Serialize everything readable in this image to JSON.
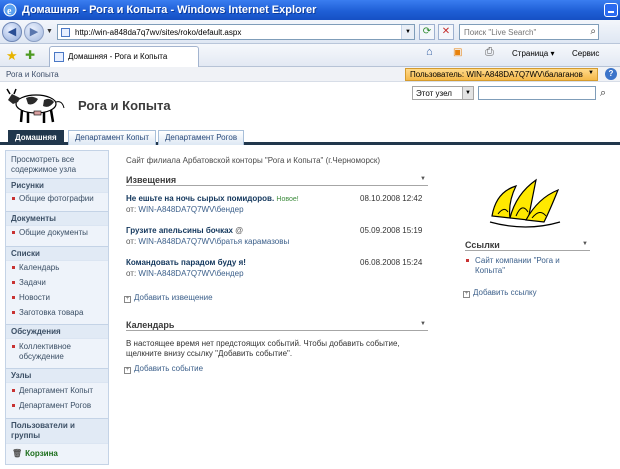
{
  "browser": {
    "window_title": "Домашняя - Рога и Копыта - Windows Internet Explorer",
    "url": "http://win-a848da7q7wv/sites/roko/default.aspx",
    "search_placeholder": "Поиск \"Live Search\"",
    "tab_title": "Домашняя - Рога и Копыта",
    "page_menu": "Страница",
    "tools_menu": "Сервис"
  },
  "site": {
    "breadcrumb": "Рога и Копыта",
    "user_menu": "Пользователь: WIN-A848DA7Q7WV\\балаганов",
    "title": "Рога и Копыта",
    "search_scope": "Этот узел",
    "tabs": [
      "Домашняя",
      "Департамент Копыт",
      "Департамент Рогов"
    ],
    "description": "Сайт филиала Арбатовской конторы \"Рога и Копыта\" (г.Черноморск)"
  },
  "leftnav": {
    "view_all": "Просмотреть все содержимое узла",
    "sections": {
      "pictures": "Рисунки",
      "pictures_items": [
        "Общие фотографии"
      ],
      "documents": "Документы",
      "documents_items": [
        "Общие документы"
      ],
      "lists": "Списки",
      "lists_items": [
        "Календарь",
        "Задачи",
        "Новости",
        "Заготовка товара"
      ],
      "discussions": "Обсуждения",
      "discussions_items": [
        "Коллективное обсуждение"
      ],
      "sites": "Узлы",
      "sites_items": [
        "Департамент Копыт",
        "Департамент Рогов"
      ],
      "people": "Пользователи и группы"
    },
    "recycle_bin": "Корзина"
  },
  "announcements": {
    "title": "Извещения",
    "items": [
      {
        "title": "Не ешьте на ночь сырых помидоров.",
        "badge": "Новое",
        "date": "08.10.2008 12:42",
        "from_label": "от:",
        "author": "WIN-A848DA7Q7WV\\бендер"
      },
      {
        "title": "Грузите апельсины бочках",
        "badge": "",
        "date": "05.09.2008 15:19",
        "from_label": "от:",
        "author": "WIN-A848DA7Q7WV\\братья карамазовы"
      },
      {
        "title": "Командовать парадом буду я!",
        "badge": "",
        "date": "06.08.2008 15:24",
        "from_label": "от:",
        "author": "WIN-A848DA7Q7WV\\бендер"
      }
    ],
    "add_link": "Добавить извещение"
  },
  "calendar": {
    "title": "Календарь",
    "empty_text": "В настоящее время нет предстоящих событий. Чтобы добавить событие, щелкните внизу ссылку \"Добавить событие\".",
    "add_link": "Добавить событие"
  },
  "links": {
    "title": "Ссылки",
    "items": [
      "Сайт компании \"Рога и Копыта\""
    ],
    "add_link": "Добавить ссылку"
  }
}
